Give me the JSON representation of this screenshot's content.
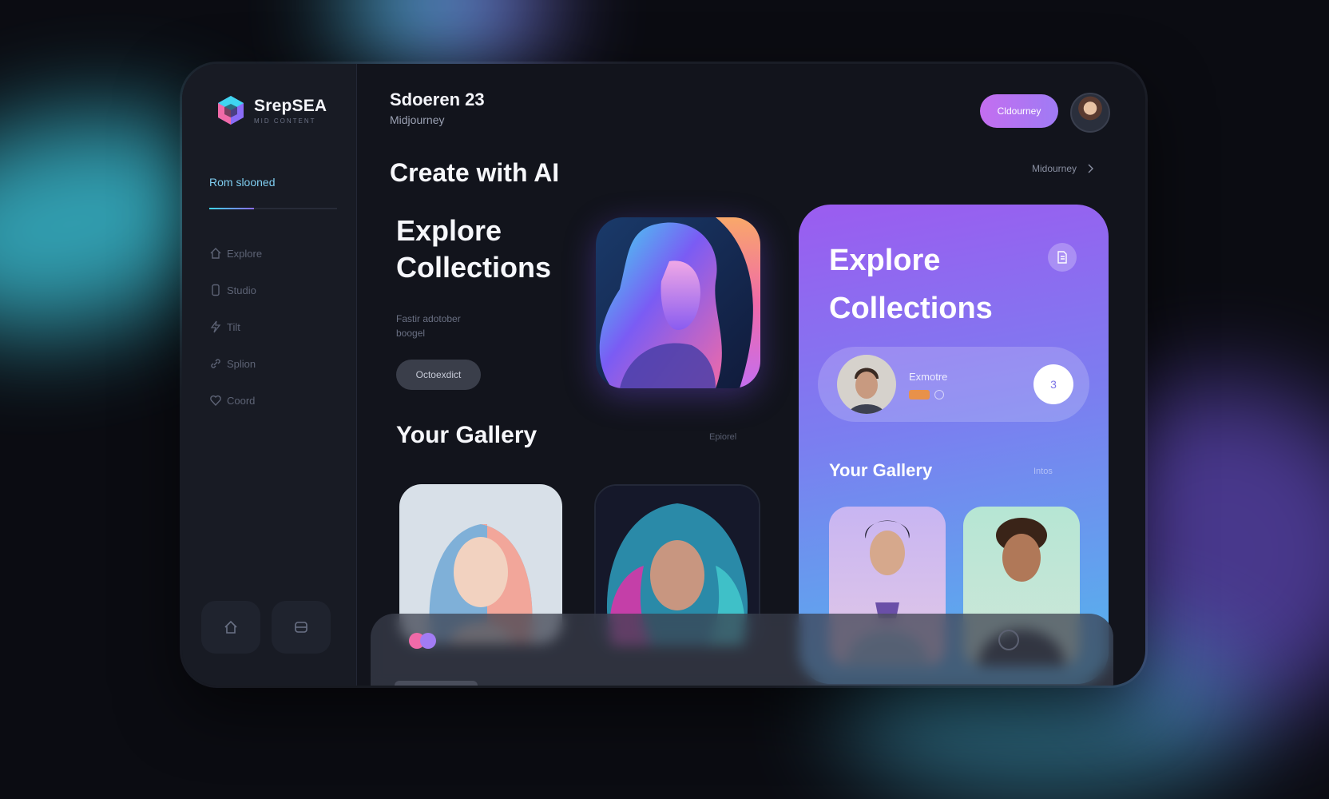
{
  "brand": {
    "name": "SrepSEA",
    "subtitle": "MID CONTENT"
  },
  "sidebar": {
    "active_label": "Rom slooned",
    "items": [
      {
        "label": "Explore",
        "icon": "home-icon"
      },
      {
        "label": "Studio",
        "icon": "phone-icon"
      },
      {
        "label": "Tilt",
        "icon": "bolt-icon"
      },
      {
        "label": "Splion",
        "icon": "link-icon"
      },
      {
        "label": "Coord",
        "icon": "heart-icon"
      }
    ],
    "bottom_buttons": [
      {
        "icon": "home-icon"
      },
      {
        "icon": "layers-icon"
      }
    ]
  },
  "header": {
    "title": "Sdoeren 23",
    "subtitle": "Midjourney",
    "pill_label": "Cldourney",
    "link_label": "Midourney"
  },
  "main": {
    "title": "Create with AI",
    "explore": {
      "title_line1": "Explore",
      "title_line2": "Collections",
      "description": "Fastir adotober boogel",
      "button_label": "Octoexdict"
    },
    "gallery": {
      "title": "Your Gallery",
      "link_label": "Epiorel"
    }
  },
  "panel": {
    "title_line1": "Explore",
    "title_line2": "Collections",
    "icon": "document-icon",
    "profile": {
      "name": "Exmotre",
      "count": "3"
    },
    "gallery_title": "Your Gallery",
    "gallery_link": "Intos"
  },
  "colors": {
    "accent_pink": "#c46ef0",
    "accent_cyan": "#3fd6f0",
    "panel_top": "#9b5cf0",
    "panel_bottom": "#52b8ec",
    "background": "#0b0c12"
  }
}
